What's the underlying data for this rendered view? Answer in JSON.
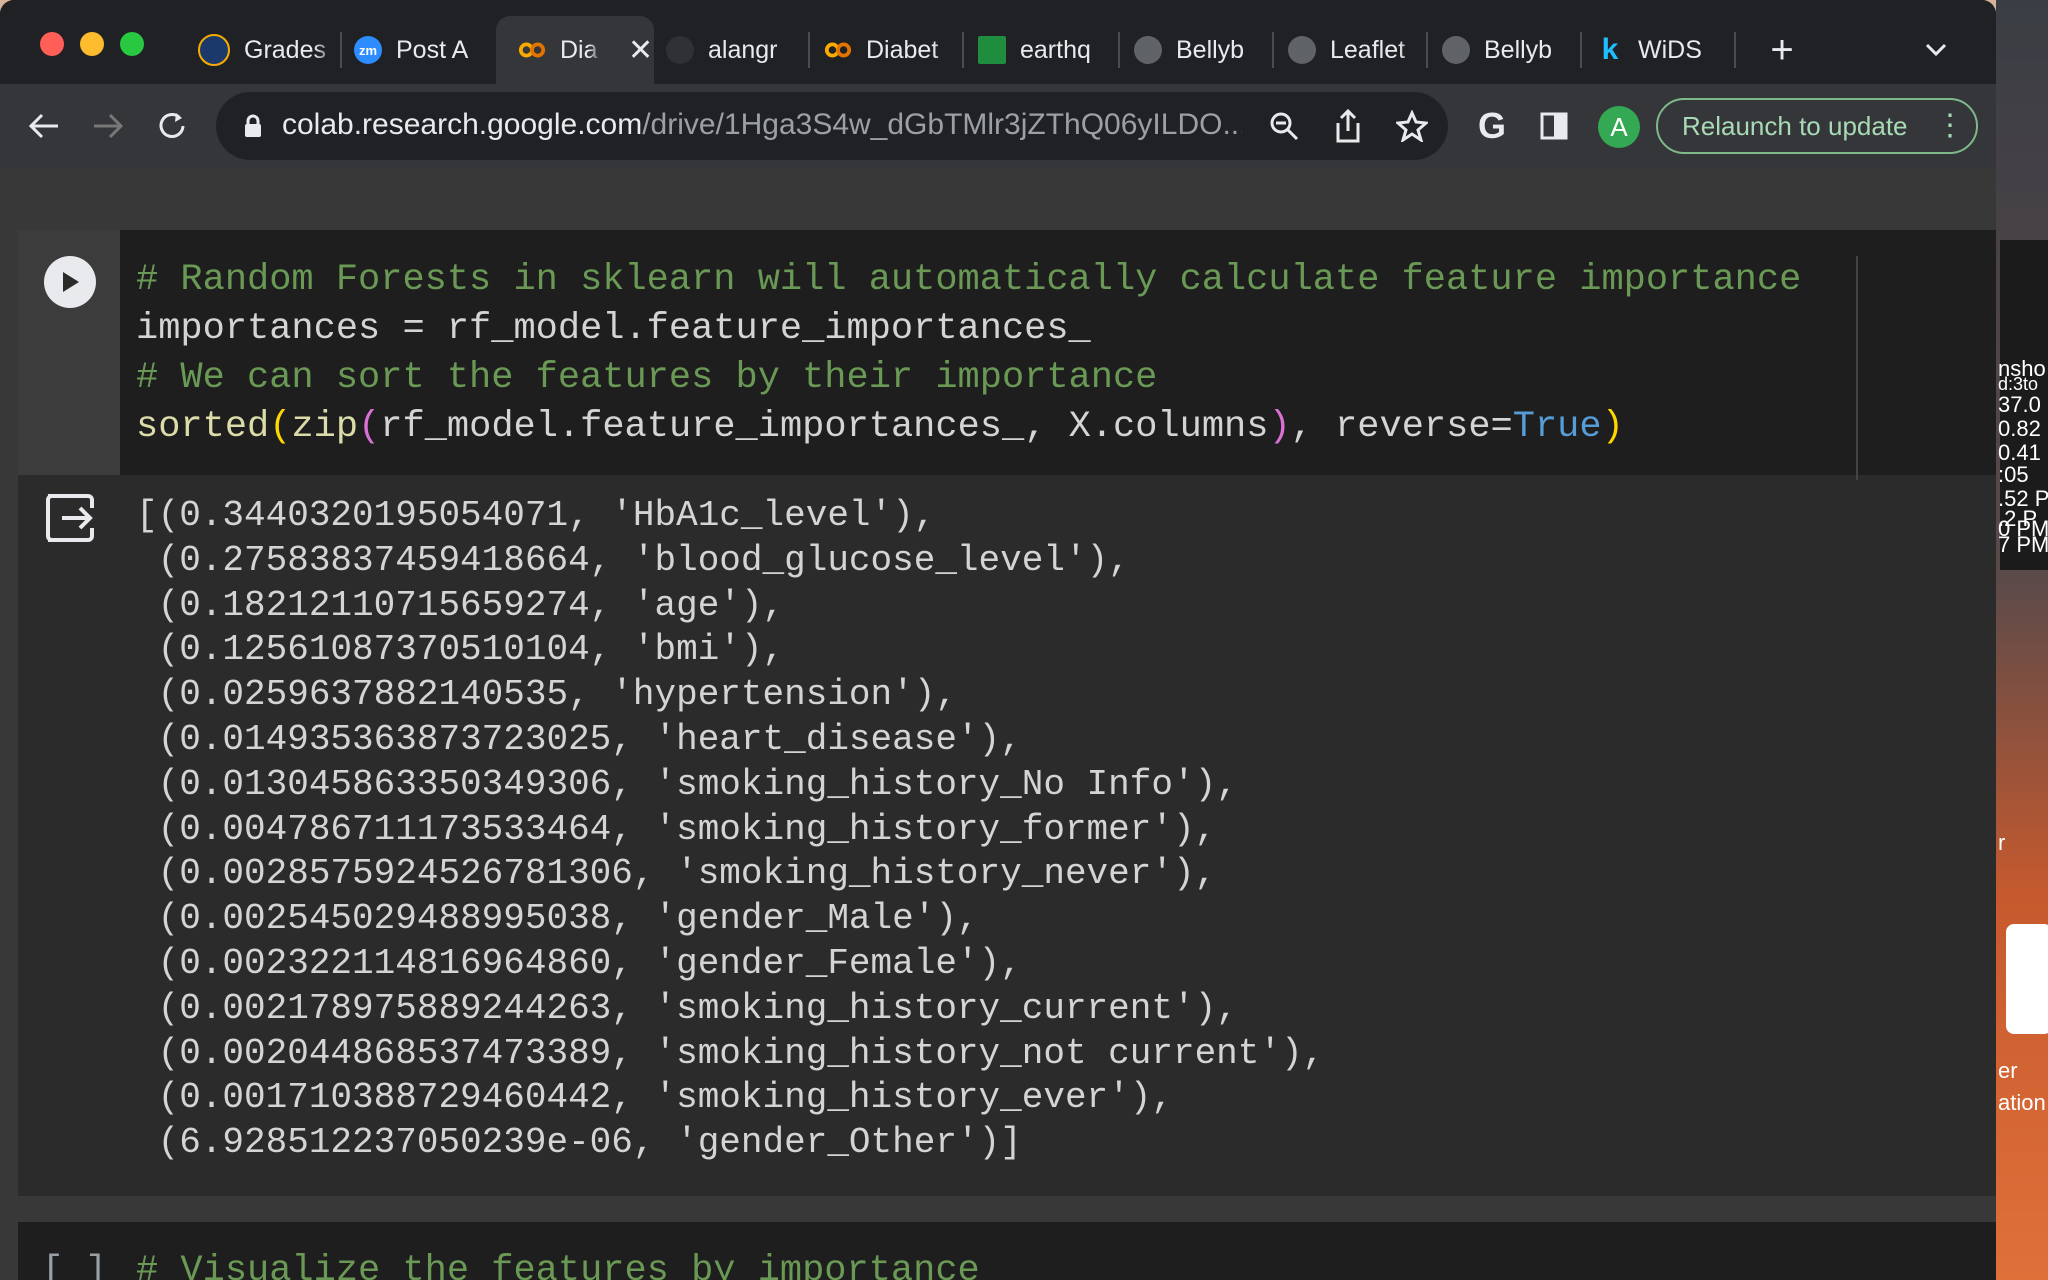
{
  "browser": {
    "tabs": [
      {
        "label": "Grades",
        "icon": "grades-icon",
        "color": "#1b3a6b"
      },
      {
        "label": "Post A",
        "icon": "zoom-icon",
        "color": "#2d8cff"
      },
      {
        "label": "Dia",
        "icon": "colab-icon",
        "color": "#f9ab00",
        "active": true
      },
      {
        "label": "alangr",
        "icon": "github-icon",
        "color": "#24292e"
      },
      {
        "label": "Diabet",
        "icon": "colab-icon",
        "color": "#f9ab00"
      },
      {
        "label": "earthq",
        "icon": "sheet-icon",
        "color": "#1e8e3e"
      },
      {
        "label": "Bellyb",
        "icon": "globe-icon",
        "color": "#9aa0a6"
      },
      {
        "label": "Leaflet",
        "icon": "globe-icon",
        "color": "#9aa0a6"
      },
      {
        "label": "Bellyb",
        "icon": "globe-icon",
        "color": "#9aa0a6"
      },
      {
        "label": "WiDS",
        "icon": "kaggle-icon",
        "color": "#20beff"
      }
    ],
    "url_host": "colab.research.google.com",
    "url_path": "/drive/1Hga3S4w_dGbTMlr3jZThQ06yILDO...",
    "relaunch_label": "Relaunch to update",
    "avatar_letter": "A",
    "icon_zm": "zm"
  },
  "notebook": {
    "code_cell": {
      "line1": "# Random Forests in sklearn will automatically calculate feature importance",
      "line2_var": "importances = rf_model.feature_importances_",
      "line3": "# We can sort the features by their importance",
      "line4_fn": "sorted",
      "line4_fn2": "zip",
      "line4_args": "rf_model.feature_importances_, X.columns",
      "line4_kw": "reverse=",
      "line4_true": "True"
    },
    "output_lines": [
      "[(0.3440320195054071, 'HbA1c_level'),",
      " (0.27583837459418664, 'blood_glucose_level'),",
      " (0.18212110715659274, 'age'),",
      " (0.12561087370510104, 'bmi'),",
      " (0.0259637882140535, 'hypertension'),",
      " (0.014935363873723025, 'heart_disease'),",
      " (0.013045863350349306, 'smoking_history_No Info'),",
      " (0.004786711173533464, 'smoking_history_former'),",
      " (0.0028575924526781306, 'smoking_history_never'),",
      " (0.002545029488995038, 'gender_Male'),",
      " (0.002322114816964860, 'gender_Female'),",
      " (0.002178975889244263, 'smoking_history_current'),",
      " (0.002044868537473389, 'smoking_history_not current'),",
      " (0.001710388729460442, 'smoking_history_ever'),",
      " (6.928512237050239e-06, 'gender_Other')]"
    ],
    "next_cell": {
      "bracket": "[ ]",
      "code": "# Visualize the features by importance"
    }
  },
  "desktop_peek": {
    "texts": [
      "nsho",
      "d:3to",
      "37.0",
      "0.82",
      "0.41",
      ":05",
      ".52 P",
      ".2 P",
      "0 PM",
      "7 PM",
      "r",
      "er",
      "ation"
    ]
  }
}
